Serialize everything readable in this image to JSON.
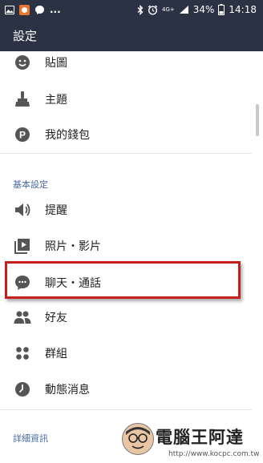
{
  "status_bar": {
    "dots": "...",
    "network": "4G+",
    "battery": "34%",
    "time": "14:18"
  },
  "header": {
    "title": "設定"
  },
  "menu": {
    "top_items": [
      {
        "label": "貼圖",
        "icon": "sticker-icon"
      },
      {
        "label": "主題",
        "icon": "theme-brush-icon"
      },
      {
        "label": "我的錢包",
        "icon": "wallet-p-icon"
      }
    ],
    "basic_header": "基本設定",
    "basic_items": [
      {
        "label": "提醒",
        "icon": "speaker-icon"
      },
      {
        "label": "照片・影片",
        "icon": "photo-video-icon"
      },
      {
        "label": "聊天・通話",
        "icon": "chat-bubble-icon"
      },
      {
        "label": "好友",
        "icon": "friends-icon"
      },
      {
        "label": "群組",
        "icon": "groups-icon"
      },
      {
        "label": "動態消息",
        "icon": "timeline-clock-icon"
      }
    ],
    "detail_header": "詳細資訊"
  },
  "watermark": {
    "title": "電腦王阿達",
    "url": "http://www.kocpc.com.tw"
  },
  "colors": {
    "header_bg": "#2b3243",
    "section_header": "#4a6aa5",
    "highlight_border": "#c6201c",
    "icon": "#555555"
  }
}
